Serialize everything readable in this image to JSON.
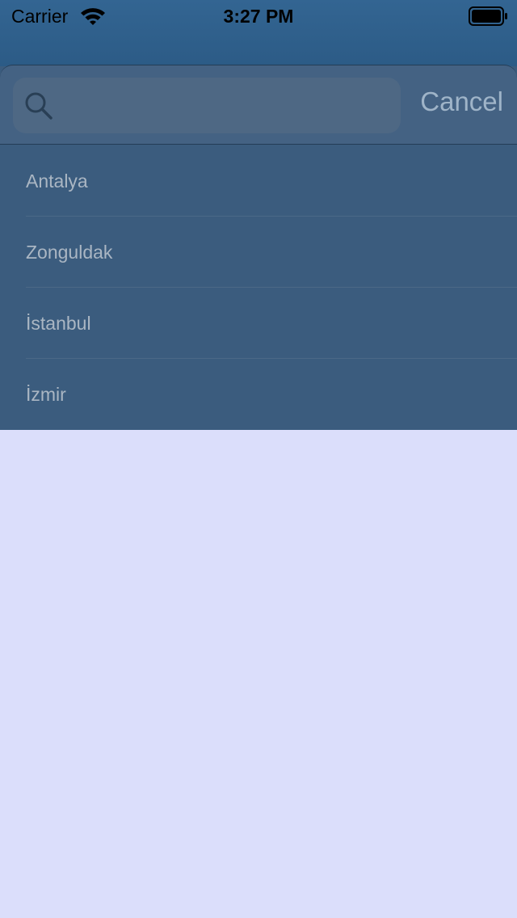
{
  "status_bar": {
    "carrier": "Carrier",
    "time": "3:27 PM",
    "wifi_icon": "wifi-icon",
    "battery_icon": "battery-icon"
  },
  "search": {
    "placeholder": "",
    "value": "",
    "cancel_label": "Cancel",
    "icon": "search-icon"
  },
  "results": [
    {
      "label": "Antalya"
    },
    {
      "label": "Zonguldak"
    },
    {
      "label": "İstanbul"
    },
    {
      "label": "İzmir"
    }
  ],
  "colors": {
    "status_bar": "#2f6090",
    "overlay": "#3b5c7e",
    "search_header": "#446283",
    "page_background": "#dbdefb",
    "cancel_text": "#9fb4c8",
    "item_text": "#aab6c3"
  }
}
